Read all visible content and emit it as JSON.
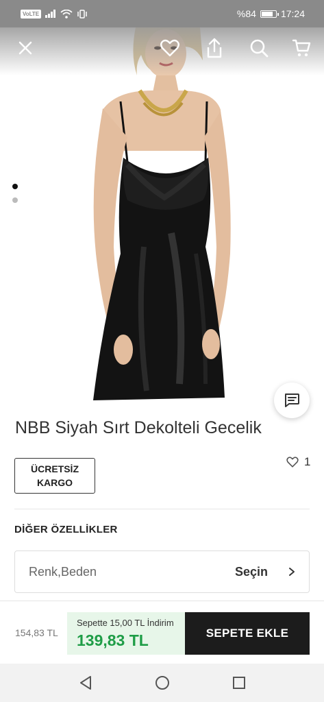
{
  "status_bar": {
    "network_badge": "VoLTE",
    "battery_text": "%84",
    "battery_level": 0.84,
    "time": "17:24"
  },
  "toolbar": {
    "close_icon": "close-icon",
    "favorite_icon": "heart-icon",
    "share_icon": "share-icon",
    "search_icon": "search-icon",
    "cart_icon": "cart-icon"
  },
  "gallery": {
    "image_count": 2,
    "active_index": 0
  },
  "product": {
    "title": "NBB Siyah Sırt Dekolteli Gecelik",
    "badge": "ÜCRETSİZ KARGO",
    "favorite_count": "1"
  },
  "details": {
    "section_title": "DİĞER ÖZELLİKLER",
    "variant_label": "Renk,Beden",
    "variant_action": "Seçin"
  },
  "purchase": {
    "old_price": "154,83 TL",
    "discount_text": "Sepette 15,00 TL İndirim",
    "new_price": "139,83 TL",
    "add_to_cart": "SEPETE EKLE"
  },
  "colors": {
    "accent_green": "#1f9d47",
    "discount_bg": "#e7f6e9",
    "button_dark": "#1c1c1c"
  }
}
